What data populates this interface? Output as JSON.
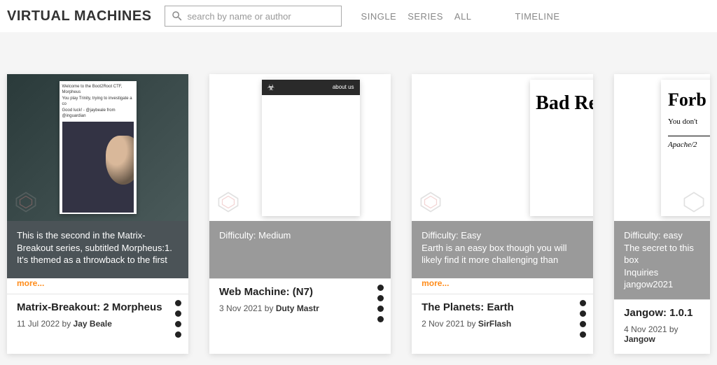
{
  "header": {
    "title": "VIRTUAL MACHINES",
    "search_placeholder": "search by name or author",
    "nav": {
      "single": "SINGLE",
      "series": "SERIES",
      "all": "ALL",
      "timeline": "TIMELINE"
    }
  },
  "more_label": "more...",
  "by_label": "by",
  "cards": [
    {
      "thumb_lines": [
        "Welcome to the Boot2Root CTF, Morpheus",
        "You play Trinity, trying to investigate a co",
        "Good luck! - @jaybeale from @inguardian"
      ],
      "desc": "This is the second in the Matrix-Breakout series, subtitled Morpheus:1. It's themed as a throwback to the first",
      "has_more": true,
      "title": "Matrix-Breakout: 2 Morpheus",
      "date": "11 Jul 2022",
      "author": "Jay Beale"
    },
    {
      "thumb_header": "about us",
      "desc": "Difficulty: Medium",
      "has_more": false,
      "title": "Web Machine: (N7)",
      "date": "3 Nov 2021",
      "author": "Duty Mastr"
    },
    {
      "thumb_big": "Bad Requ",
      "desc": "Difficulty: Easy\nEarth is an easy box though you will likely find it more challenging than",
      "has_more": true,
      "title": "The Planets: Earth",
      "date": "2 Nov 2021",
      "author": "SirFlash"
    },
    {
      "thumb_big": "Forb",
      "thumb_sub": "You don't",
      "thumb_foot": "Apache/2",
      "desc": "Difficulty: easy\nThe secret to this box\nInquiries jangow2021",
      "has_more": false,
      "title": "Jangow: 1.0.1",
      "date": "4 Nov 2021",
      "author": "Jangow"
    }
  ]
}
